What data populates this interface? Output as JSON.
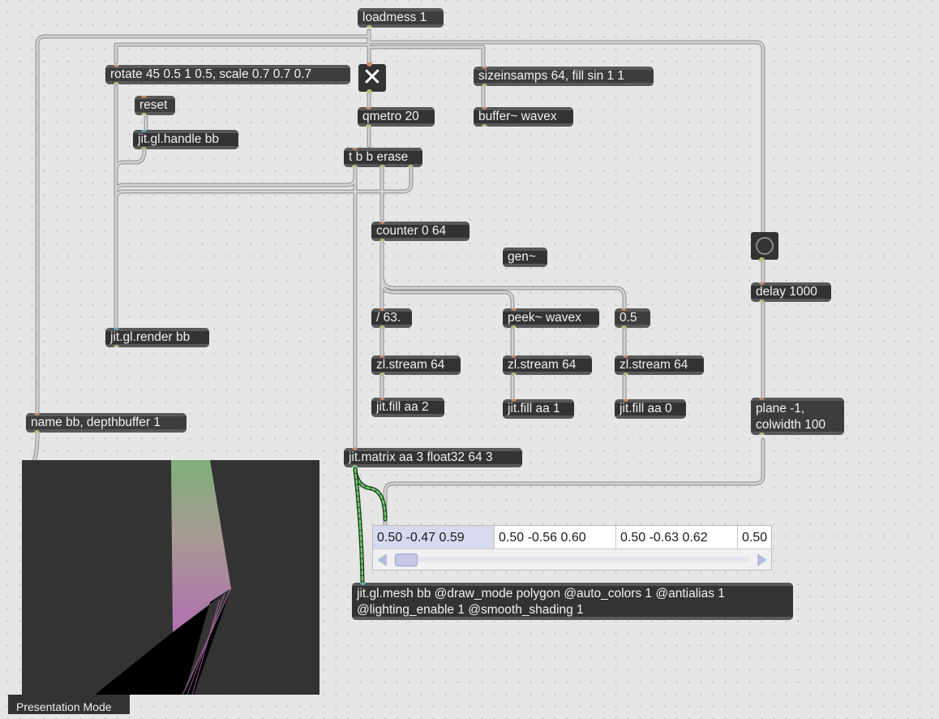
{
  "objects": {
    "loadmess": "loadmess 1",
    "rotate_msg": "rotate 45 0.5 1 0.5, scale 0.7 0.7 0.7",
    "reset_msg": "reset",
    "handle": "jit.gl.handle bb",
    "sizeinsamps_msg": "sizeinsamps 64, fill sin 1 1",
    "buffer": "buffer~ wavex",
    "qmetro": "qmetro 20",
    "trigger": "t b b erase",
    "counter": "counter 0 64",
    "gen": "gen~",
    "div": "/ 63.",
    "peek": "peek~ wavex",
    "const_msg": "0.5",
    "zl1": "zl.stream 64",
    "zl2": "zl.stream 64",
    "zl3": "zl.stream 64",
    "fill2": "jit.fill aa 2",
    "fill1": "jit.fill aa 1",
    "fill0": "jit.fill aa 0",
    "render": "jit.gl.render bb",
    "name_msg": "name bb, depthbuffer 1",
    "delay": "delay 1000",
    "plane_line1": "plane -1,",
    "plane_line2": "colwidth 100",
    "matrix": "jit.matrix aa 3 float32 64 3",
    "mesh_line1": "jit.gl.mesh bb @draw_mode polygon @auto_colors 1 @antialias 1",
    "mesh_line2": "@lighting_enable 1 @smooth_shading 1"
  },
  "toggle_state": "on",
  "cellblock": {
    "cells": [
      "0.50 -0.47 0.59",
      "0.50 -0.56 0.60",
      "0.50 -0.63 0.62",
      "0.50"
    ],
    "selected_index": 0
  },
  "footer": {
    "mode_button": "Presentation Mode"
  },
  "colors": {
    "canvas": "#e6e6e6",
    "object_fill": "#333333",
    "object_text": "#f2f2f2",
    "patchcord": "#b4b4b4",
    "matrix_cord": "#5bb85b",
    "inlet": "#c98b6c",
    "outlet": "#b9bf7a",
    "render_bg": "#333333"
  }
}
